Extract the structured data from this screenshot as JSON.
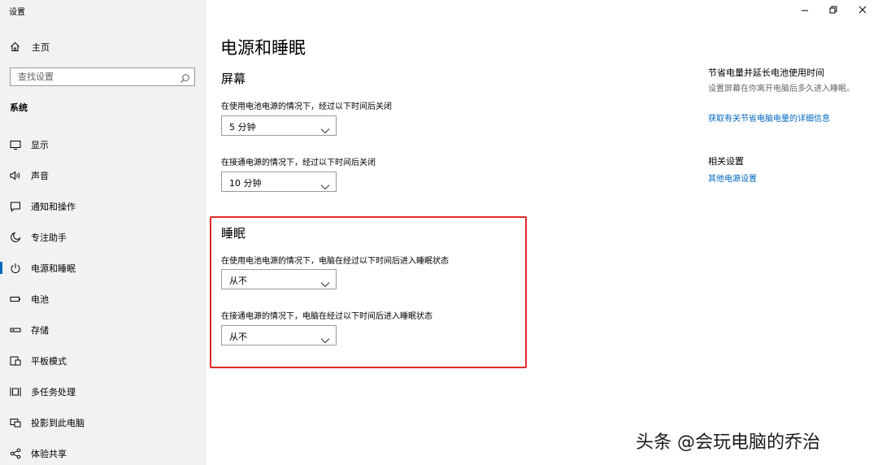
{
  "window": {
    "title": "设置",
    "controls": [
      "minimize",
      "restore",
      "close"
    ]
  },
  "sidebar": {
    "home_label": "主页",
    "search_placeholder": "查找设置",
    "section_label": "系统",
    "items": [
      {
        "label": "显示",
        "icon": "monitor-icon"
      },
      {
        "label": "声音",
        "icon": "speaker-icon"
      },
      {
        "label": "通知和操作",
        "icon": "notification-icon"
      },
      {
        "label": "专注助手",
        "icon": "moon-icon"
      },
      {
        "label": "电源和睡眠",
        "icon": "power-icon",
        "active": true
      },
      {
        "label": "电池",
        "icon": "battery-icon"
      },
      {
        "label": "存储",
        "icon": "storage-icon"
      },
      {
        "label": "平板模式",
        "icon": "tablet-icon"
      },
      {
        "label": "多任务处理",
        "icon": "multitask-icon"
      },
      {
        "label": "投影到此电脑",
        "icon": "project-icon"
      },
      {
        "label": "体验共享",
        "icon": "share-icon"
      }
    ]
  },
  "main": {
    "title": "电源和睡眠",
    "screen": {
      "heading": "屏幕",
      "battery_label": "在使用电池电源的情况下，经过以下时间后关闭",
      "battery_value": "5 分钟",
      "plugged_label": "在接通电源的情况下，经过以下时间后关闭",
      "plugged_value": "10 分钟"
    },
    "sleep": {
      "heading": "睡眠",
      "battery_label": "在使用电池电源的情况下，电脑在经过以下时间后进入睡眠状态",
      "battery_value": "从不",
      "plugged_label": "在接通电源的情况下，电脑在经过以下时间后进入睡眠状态",
      "plugged_value": "从不"
    },
    "highlight_color": "#e02a2a"
  },
  "right": {
    "save_title": "节省电量并延长电池使用时间",
    "save_text": "设置屏幕在你离开电脑后多久进入睡眠。",
    "save_link": "获取有关节省电脑电量的详细信息",
    "related_title": "相关设置",
    "related_link": "其他电源设置"
  },
  "watermark": "头条 @会玩电脑的乔治",
  "colors": {
    "accent": "#0067c0",
    "sidebar_bg": "#f2f2f2"
  }
}
